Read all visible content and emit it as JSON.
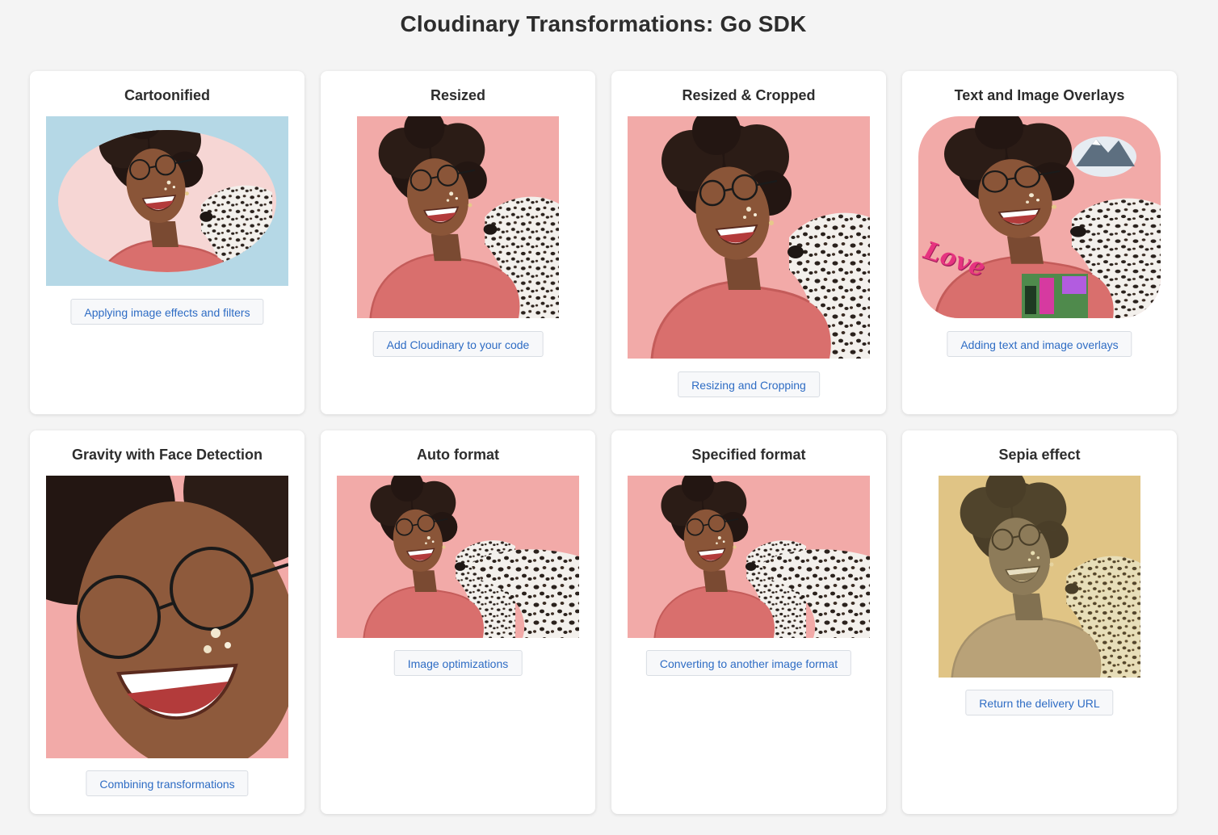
{
  "page": {
    "title": "Cloudinary Transformations: Go SDK"
  },
  "colors": {
    "accent_link": "#2e6cc4",
    "card_bg": "#ffffff",
    "page_bg": "#f4f4f4",
    "photo_pink": "#f2aaa8",
    "cartoon_blue": "#b5d8e6",
    "sepia": "#e8cf93"
  },
  "cards": [
    {
      "title": "Cartoonified",
      "button": "Applying image effects and filters",
      "image": "cartoonified-photo"
    },
    {
      "title": "Resized",
      "button": "Add Cloudinary to your code",
      "image": "resized-photo"
    },
    {
      "title": "Resized & Cropped",
      "button": "Resizing and Cropping",
      "image": "resized-cropped-photo"
    },
    {
      "title": "Text and Image Overlays",
      "button": "Adding text and image overlays",
      "image": "overlays-photo",
      "overlay_text": "Love"
    },
    {
      "title": "Gravity with Face Detection",
      "button": "Combining transformations",
      "image": "face-detection-photo"
    },
    {
      "title": "Auto format",
      "button": "Image optimizations",
      "image": "auto-format-photo"
    },
    {
      "title": "Specified format",
      "button": "Converting to another image format",
      "image": "specified-format-photo"
    },
    {
      "title": "Sepia effect",
      "button": "Return the delivery URL",
      "image": "sepia-photo"
    }
  ]
}
